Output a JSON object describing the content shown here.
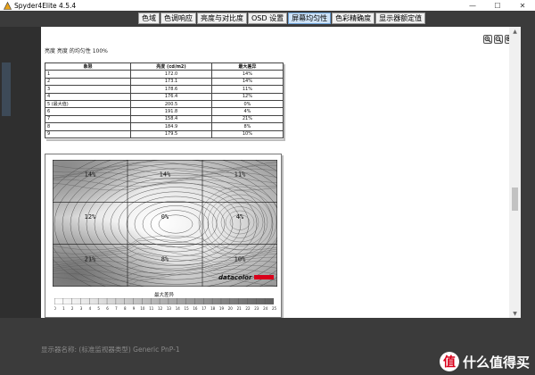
{
  "window": {
    "title": "Spyder4Elite 4.5.4",
    "minimize": "—",
    "maximize": "☐",
    "close": "✕"
  },
  "tabs": [
    {
      "label": "色域",
      "active": false
    },
    {
      "label": "色调响应",
      "active": false
    },
    {
      "label": "亮度与对比度",
      "active": false
    },
    {
      "label": "OSD 设置",
      "active": false
    },
    {
      "label": "屏幕均匀性",
      "active": true
    },
    {
      "label": "色彩精确度",
      "active": false
    },
    {
      "label": "显示器额定值",
      "active": false
    }
  ],
  "report": {
    "title": "亮度 亮度 的均匀性 100%"
  },
  "table": {
    "headers": [
      "象限",
      "亮度 (cd/m2)",
      "最大差异"
    ],
    "rows": [
      [
        "1",
        "172.0",
        "14%"
      ],
      [
        "2",
        "173.1",
        "14%"
      ],
      [
        "3",
        "178.6",
        "11%"
      ],
      [
        "4",
        "176.4",
        "12%"
      ],
      [
        "5 (最大值)",
        "200.5",
        "0%"
      ],
      [
        "6",
        "191.8",
        "4%"
      ],
      [
        "7",
        "158.4",
        "21%"
      ],
      [
        "8",
        "184.9",
        "8%"
      ],
      [
        "9",
        "179.5",
        "10%"
      ]
    ]
  },
  "map": {
    "cells": [
      "14%",
      "14%",
      "11%",
      "12%",
      "0%",
      "4%",
      "21%",
      "8%",
      "10%"
    ],
    "brand": "datacolor",
    "legend_title": "最大差异",
    "legend_ticks": [
      "0",
      "1",
      "2",
      "3",
      "4",
      "5",
      "6",
      "7",
      "8",
      "9",
      "10",
      "11",
      "12",
      "13",
      "14",
      "15",
      "16",
      "17",
      "18",
      "19",
      "20",
      "21",
      "22",
      "23",
      "24",
      "25"
    ]
  },
  "status": {
    "text": "显示器名称: (标准监视器类型) Generic PnP-1"
  },
  "watermark": {
    "icon": "值",
    "text": "什么值得买"
  },
  "icons": {
    "zoom_in": "zoom-in-icon",
    "zoom_out": "zoom-out-icon",
    "zoom_fit": "zoom-fit-icon"
  },
  "colors": {
    "active_tab": "#cfe3f7",
    "brand_red": "#d9001b"
  }
}
